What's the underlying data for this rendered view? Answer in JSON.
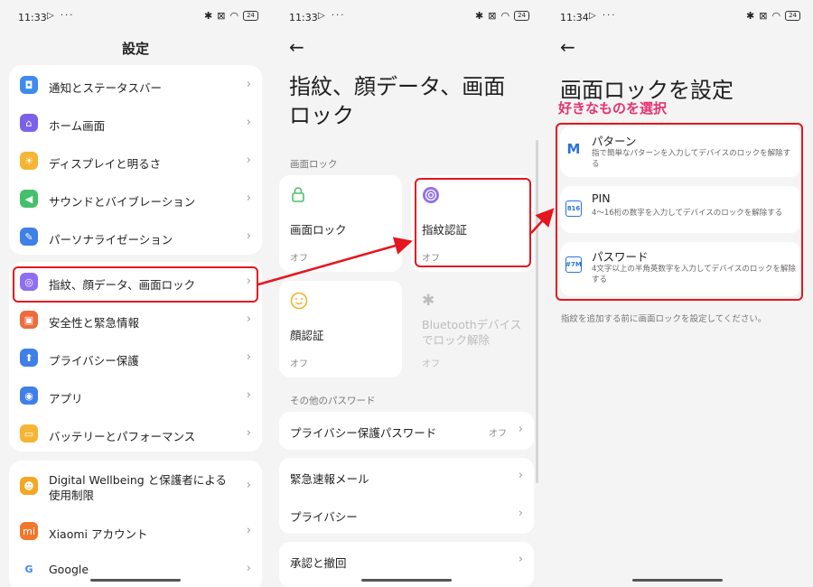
{
  "panel1": {
    "status_time": "11:33",
    "status_left": "▷ ···",
    "battery": "24",
    "title": "設定",
    "group1": [
      {
        "label": "通知とステータスバー",
        "icon": "bell-icon",
        "color": "#3f8bf0",
        "glyph": "◘"
      },
      {
        "label": "ホーム画面",
        "icon": "home-icon",
        "color": "#7b61ea",
        "glyph": "⌂"
      },
      {
        "label": "ディスプレイと明るさ",
        "icon": "sun-icon",
        "color": "#f5b534",
        "glyph": "☀"
      },
      {
        "label": "サウンドとバイブレーション",
        "icon": "speaker-icon",
        "color": "#44c06a",
        "glyph": "◀"
      },
      {
        "label": "パーソナライゼーション",
        "icon": "brush-icon",
        "color": "#3f7fe8",
        "glyph": "✎"
      }
    ],
    "group2": [
      {
        "label": "指紋、顔データ、画面ロック",
        "icon": "fingerprint-icon",
        "color": "#8f6ff0",
        "glyph": "◎"
      },
      {
        "label": "安全性と緊急情報",
        "icon": "emergency-icon",
        "color": "#ee6b3d",
        "glyph": "▣"
      },
      {
        "label": "プライバシー保護",
        "icon": "privacy-icon",
        "color": "#3f7fe8",
        "glyph": "⬆"
      },
      {
        "label": "アプリ",
        "icon": "apps-icon",
        "color": "#3f7fe8",
        "glyph": "◉"
      },
      {
        "label": "バッテリーとパフォーマンス",
        "icon": "battery-icon",
        "color": "#f5b534",
        "glyph": "▭"
      }
    ],
    "group3": [
      {
        "label_line1": "Digital Wellbeing と保護者による",
        "label_line2": "使用制限",
        "icon": "wellbeing-icon",
        "color": "#f5a623",
        "glyph": "☻"
      },
      {
        "label": "Xiaomi アカウント",
        "icon": "xiaomi-icon",
        "color": "#f2772a",
        "glyph": "mi"
      },
      {
        "label": "Google",
        "icon": "google-icon",
        "color": "#ffffff",
        "glyph": "G"
      }
    ]
  },
  "panel2": {
    "status_time": "11:33",
    "status_left": "▷ ···",
    "battery": "24",
    "title": "指紋、顔データ、画面ロック",
    "section_lock": "画面ロック",
    "tiles": [
      {
        "label": "画面ロック",
        "sub": "オフ",
        "icon": "lock-icon",
        "glyph": "🔒"
      },
      {
        "label": "指紋認証",
        "sub": "オフ",
        "icon": "fingerprint-icon",
        "glyph": "◎"
      },
      {
        "label": "顔認証",
        "sub": "オフ",
        "icon": "face-icon",
        "glyph": "☺"
      },
      {
        "label": "Bluetoothデバイスでロック解除",
        "sub": "オフ",
        "icon": "bluetooth-icon",
        "glyph": "✱"
      }
    ],
    "section_other": "その他のパスワード",
    "privacy_password": {
      "label": "プライバシー保護パスワード",
      "value": "オフ"
    },
    "emergency_email": "緊急速報メール",
    "privacy": "プライバシー",
    "consent": "承認と撤回"
  },
  "panel3": {
    "status_time": "11:34",
    "status_left": "▷ ···",
    "battery": "24",
    "title": "画面ロックを設定",
    "annotation": "好きなものを選択",
    "options": [
      {
        "title": "パターン",
        "desc": "指で簡単なパターンを入力してデバイスのロックを解除する",
        "icon": "pattern-icon",
        "glyph": "M"
      },
      {
        "title": "PIN",
        "desc": "4〜16桁の数字を入力してデバイスのロックを解除する",
        "icon": "pin-icon",
        "glyph": "816"
      },
      {
        "title": "パスワード",
        "desc": "4文字以上の半角英数字を入力してデバイスのロックを解除する",
        "icon": "password-icon",
        "glyph": "#7M"
      }
    ],
    "hint": "指紋を追加する前に画面ロックを設定してください。"
  },
  "colors": {
    "highlight": "#e4161e",
    "annotation": "#e8316f",
    "accent": "#2b73d8"
  }
}
